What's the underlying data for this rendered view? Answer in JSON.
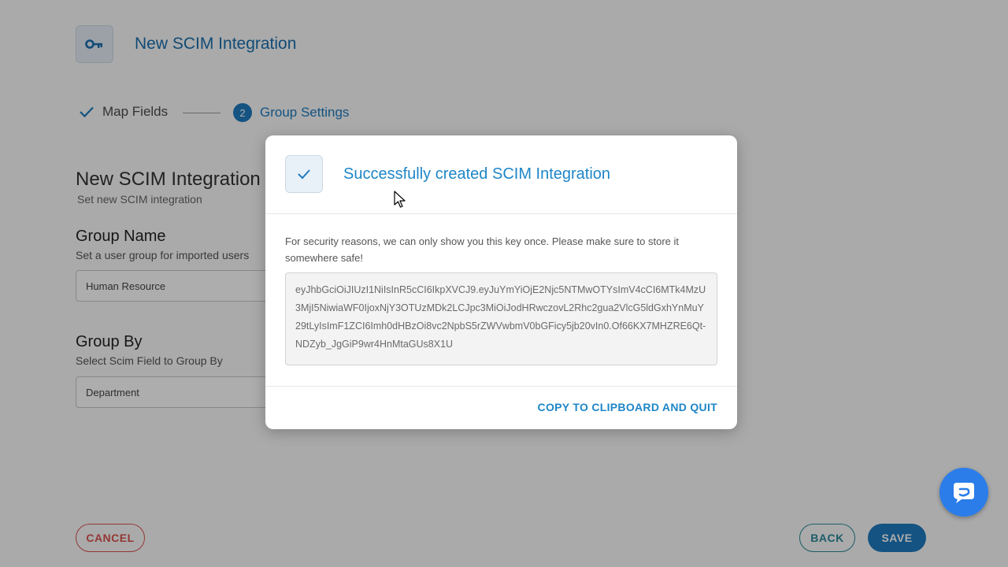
{
  "header": {
    "title": "New SCIM Integration",
    "icon": "key-icon"
  },
  "stepper": {
    "steps": [
      {
        "label": "Map Fields",
        "state": "done"
      },
      {
        "label": "Group Settings",
        "number": "2",
        "state": "active"
      }
    ]
  },
  "form": {
    "title": "New SCIM Integration",
    "subtitle": "Set new SCIM integration",
    "group_name": {
      "label": "Group Name",
      "hint": "Set a user group for imported users",
      "value": "Human Resource"
    },
    "group_by": {
      "label": "Group By",
      "hint": "Select Scim Field to Group By",
      "value": "Department"
    }
  },
  "footer": {
    "cancel_label": "CANCEL",
    "back_label": "BACK",
    "save_label": "SAVE"
  },
  "modal": {
    "title": "Successfully created SCIM Integration",
    "message": "For security reasons, we can only show you this key once. Please make sure to store it somewhere safe!",
    "key": "eyJhbGciOiJIUzI1NiIsInR5cCI6IkpXVCJ9.eyJuYmYiOjE2Njc5NTMwOTYsImV4cCI6MTk4MzU3MjI5NiwiaWF0IjoxNjY3OTUzMDk2LCJpc3MiOiJodHRwczovL2Rhc2gua2VlcG5ldGxhYnMuY29tLyIsImF1ZCI6Imh0dHBzOi8vc2NpbS5rZWVwbmV0bGFicy5jb20vIn0.Of66KX7MHZRE6Qt-NDZyb_JgGiP9wr4HnMtaGUs8X1U",
    "copy_label": "COPY TO CLIPBOARD AND QUIT"
  },
  "colors": {
    "primary": "#1e7bc0",
    "danger": "#d9534f",
    "secondary": "#2a8a9a",
    "chat": "#2b7de9"
  }
}
